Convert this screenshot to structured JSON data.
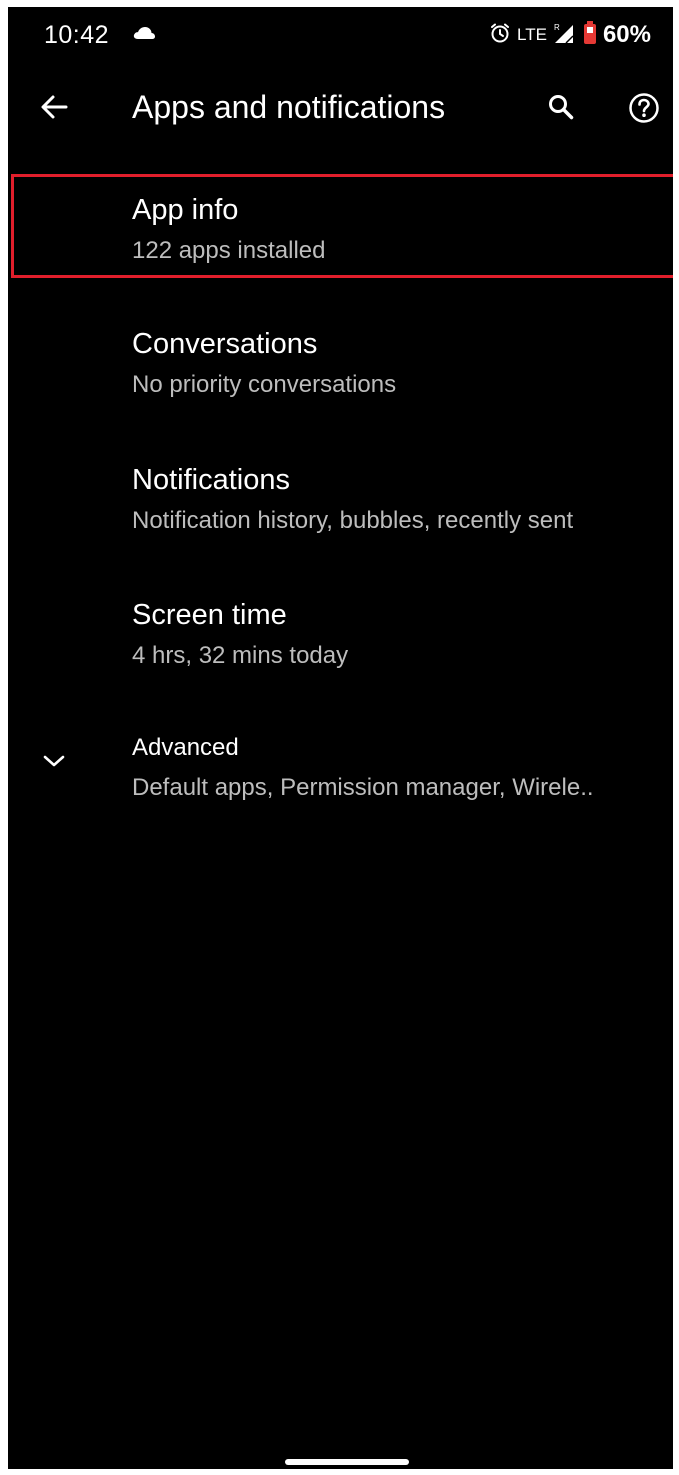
{
  "status_bar": {
    "time": "10:42",
    "network": "LTE",
    "roaming": "R",
    "battery": "60%",
    "icons": [
      "cloud-icon",
      "alarm-icon",
      "signal-icon",
      "battery-icon"
    ],
    "battery_color": "#e53935"
  },
  "app_bar": {
    "title": "Apps and notifications",
    "back_icon": "arrow-back-icon",
    "search_icon": "search-icon",
    "help_icon": "help-icon"
  },
  "items": [
    {
      "title": "App info",
      "summary": "122 apps installed",
      "highlighted": true
    },
    {
      "title": "Conversations",
      "summary": "No priority conversations"
    },
    {
      "title": "Notifications",
      "summary": "Notification history, bubbles, recently sent"
    },
    {
      "title": "Screen time",
      "summary": "4 hrs, 32 mins today"
    }
  ],
  "advanced": {
    "title": "Advanced",
    "summary": "Default apps, Permission manager, Wirele..",
    "icon": "chevron-down-icon"
  },
  "colors": {
    "background": "#000000",
    "highlight": "#e01e2b",
    "primary_text": "#ffffff",
    "secondary_text": "#bdbdbd"
  }
}
